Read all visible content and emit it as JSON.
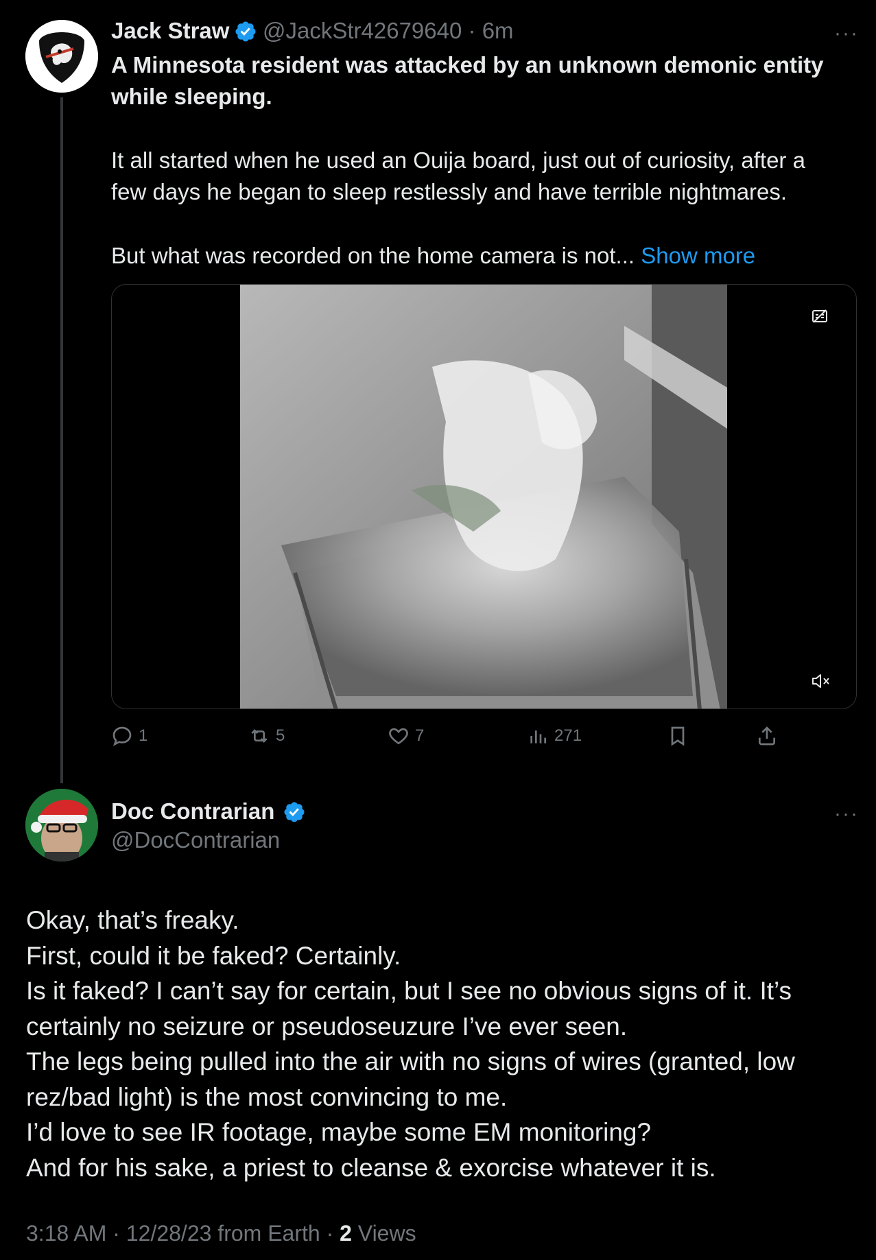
{
  "tweet": {
    "author_name": "Jack Straw",
    "handle": "@JackStr42679640",
    "separator": "·",
    "time": "6m",
    "more": "···",
    "headline_line1": "A Minnesota resident was attacked by an unknown demonic entity",
    "headline_line2": "while sleeping.",
    "body_line1": "It all started when he used an Ouija board, just out of curiosity, after a",
    "body_line2": "few days he began to sleep restlessly and have terrible nightmares.",
    "body_line3": "But what was recorded on the home camera is not...",
    "show_more": "Show more",
    "stats": {
      "replies": "1",
      "reposts": "5",
      "likes": "7",
      "views": "271"
    },
    "icons": [
      "reply-icon",
      "repost-icon",
      "like-icon",
      "views-icon",
      "bookmark-icon",
      "share-icon",
      "captions-icon",
      "mute-icon"
    ]
  },
  "reply": {
    "author_name": "Doc Contrarian",
    "handle": "@DocContrarian",
    "more": "···",
    "lines": [
      "Okay, that’s freaky.",
      "First, could it be faked? Certainly.",
      "Is it faked? I can’t say for certain, but I see no obvious signs of it. It’s",
      "certainly no seizure or pseudoseuzure I’ve ever seen.",
      "The legs being pulled into the air with no signs of wires (granted, low",
      "rez/bad light) is the most convincing to me.",
      "I’d love to see IR footage, maybe some EM monitoring?",
      "And for his sake, a priest to cleanse & exorcise whatever it is."
    ],
    "meta_time": "3:18 AM",
    "meta_date": "12/28/23 from Earth",
    "meta_sep": "·",
    "views_count": "2",
    "views_label": "Views"
  },
  "colors": {
    "background": "#000000",
    "text": "#e7e9ea",
    "secondary": "#71767b",
    "accent": "#1d9bf0"
  }
}
